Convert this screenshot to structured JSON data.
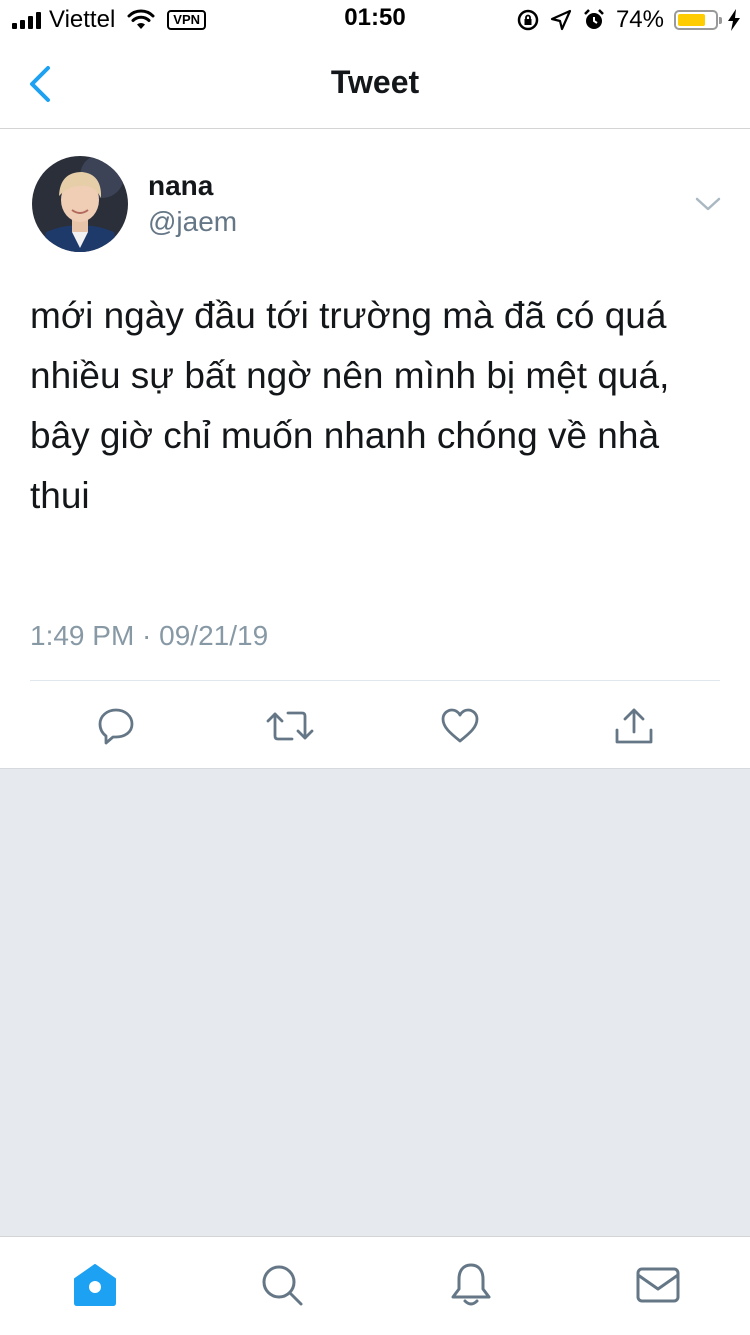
{
  "status_bar": {
    "carrier": "Viettel",
    "vpn": "VPN",
    "time": "01:50",
    "battery_percent": "74%",
    "battery_level": 0.74,
    "battery_color": "#ffcc00",
    "icons": [
      "signal-icon",
      "wifi-icon",
      "rotation-lock-icon",
      "location-icon",
      "alarm-icon",
      "charging-icon"
    ]
  },
  "nav": {
    "title": "Tweet",
    "back_icon": "chevron-left-icon",
    "accent": "#1da1f2"
  },
  "tweet": {
    "author_name": "nana",
    "author_handle": "@jaem",
    "text": "mới ngày đầu tới trường mà đã có quá nhiều sự bất ngờ nên mình bị mệt quá, bây giờ chỉ muốn nhanh chóng về nhà thui",
    "timestamp": "1:49 PM · 09/21/19",
    "actions": [
      "reply-icon",
      "retweet-icon",
      "like-icon",
      "share-icon"
    ]
  },
  "tab_bar": {
    "tabs": [
      "home-icon",
      "search-icon",
      "notifications-icon",
      "messages-icon"
    ],
    "active": "home-icon"
  }
}
